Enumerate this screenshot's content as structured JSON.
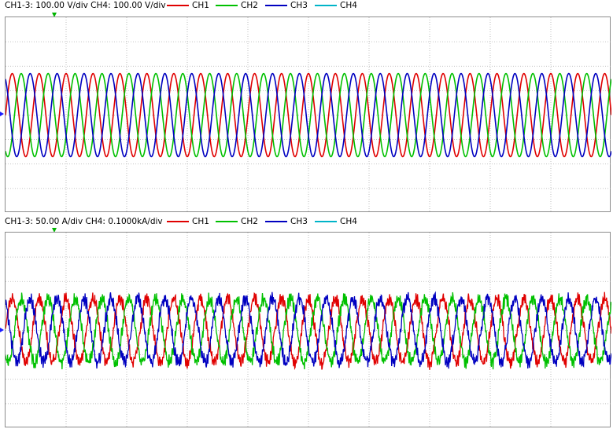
{
  "colors": {
    "ch1": "#e00000",
    "ch2": "#00c000",
    "ch3": "#0000c0",
    "ch4": "#00b4c8",
    "grid": "#b0b0b0"
  },
  "panels": [
    {
      "scale_text": "CH1-3: 100.00 V/div  CH4: 100.00 V/div",
      "legend": [
        "CH1",
        "CH2",
        "CH3",
        "CH4"
      ]
    },
    {
      "scale_text": "CH1-3:  50.00 A/div  CH4: 0.1000kA/div",
      "legend": [
        "CH1",
        "CH2",
        "CH3",
        "CH4"
      ]
    }
  ],
  "chart_data": [
    {
      "type": "line",
      "title": "",
      "grid": true,
      "divisions": {
        "x": 10,
        "y": 8
      },
      "ylim_div": [
        -4,
        4
      ],
      "series": [
        {
          "name": "CH1",
          "shape": "sine",
          "cycles": 22.5,
          "amplitude_div": 1.7,
          "phase_deg": 0,
          "noise_div": 0.0
        },
        {
          "name": "CH2",
          "shape": "sine",
          "cycles": 22.5,
          "amplitude_div": 1.7,
          "phase_deg": -120,
          "noise_div": 0.0
        },
        {
          "name": "CH3",
          "shape": "sine",
          "cycles": 22.5,
          "amplitude_div": 1.7,
          "phase_deg": 120,
          "noise_div": 0.0
        }
      ]
    },
    {
      "type": "line",
      "title": "",
      "grid": true,
      "divisions": {
        "x": 10,
        "y": 8
      },
      "ylim_div": [
        -4,
        4
      ],
      "series": [
        {
          "name": "CH1",
          "shape": "sine",
          "cycles": 22.5,
          "amplitude_div": 1.3,
          "phase_deg": 0,
          "noise_div": 0.2
        },
        {
          "name": "CH2",
          "shape": "sine",
          "cycles": 22.5,
          "amplitude_div": 1.3,
          "phase_deg": -120,
          "noise_div": 0.2
        },
        {
          "name": "CH3",
          "shape": "sine",
          "cycles": 22.5,
          "amplitude_div": 1.3,
          "phase_deg": 120,
          "noise_div": 0.2
        }
      ]
    }
  ]
}
